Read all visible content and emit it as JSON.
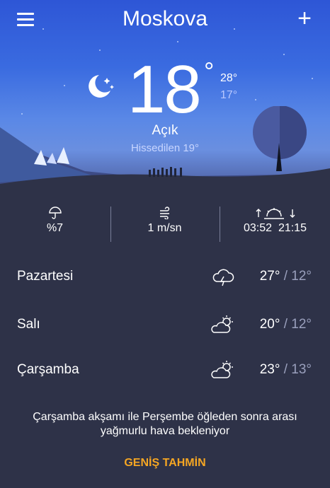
{
  "header": {
    "city": "Moskova",
    "menu_icon": "menu-icon",
    "add_icon": "plus-icon",
    "add_label": "+"
  },
  "current": {
    "temp": "18",
    "deg": "°",
    "high": "28°",
    "low": "17°",
    "condition": "Açık",
    "feels_like": "Hissedilen 19°",
    "icon": "moon-stars-icon"
  },
  "stats": {
    "precip": {
      "icon": "umbrella-icon",
      "value": "%7"
    },
    "wind": {
      "icon": "wind-icon",
      "value": "1 m/sn"
    },
    "sun": {
      "icon": "sunrise-sunset-icon",
      "sunrise": "03:52",
      "sunset": "21:15"
    }
  },
  "forecast": [
    {
      "day": "Pazartesi",
      "icon": "thunderstorm-icon",
      "high": "27°",
      "sep": " / ",
      "low": "12°"
    },
    {
      "day": "Salı",
      "icon": "partly-cloudy-icon",
      "high": "20°",
      "sep": " / ",
      "low": "12°"
    },
    {
      "day": "Çarşamba",
      "icon": "partly-cloudy-icon",
      "high": "23°",
      "sep": " / ",
      "low": "13°"
    }
  ],
  "note": "Çarşamba akşamı ile Perşembe öğleden sonra arası yağmurlu hava bekleniyor",
  "more_label": "GENİŞ TAHMİN",
  "colors": {
    "background": "#2e3248",
    "accent": "#f5a623",
    "sky_top": "#2e56d6"
  }
}
